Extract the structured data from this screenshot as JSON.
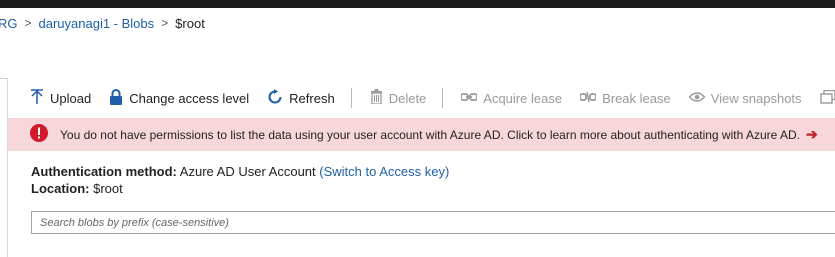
{
  "breadcrumb": {
    "items": [
      "RG",
      "daruyanagi1 - Blobs",
      "$root"
    ],
    "separator": ">"
  },
  "toolbar": {
    "upload": "Upload",
    "change_access": "Change access level",
    "refresh": "Refresh",
    "delete": "Delete",
    "acquire_lease": "Acquire lease",
    "break_lease": "Break lease",
    "view_snapshots": "View snapshots"
  },
  "banner": {
    "message": "You do not have permissions to list the data using your user account with Azure AD. Click to learn more about authenticating with Azure AD.",
    "arrow": "➔",
    "background": "#f8d7da",
    "icon_color": "#d11a2a"
  },
  "info": {
    "auth_label": "Authentication method:",
    "auth_value": "Azure AD User Account",
    "auth_switch": "(Switch to Access key)",
    "location_label": "Location:",
    "location_value": "$root"
  },
  "search": {
    "placeholder": "Search blobs by prefix (case-sensitive)"
  },
  "colors": {
    "accent": "#1f5fa8",
    "disabled": "#9a9a9a"
  }
}
